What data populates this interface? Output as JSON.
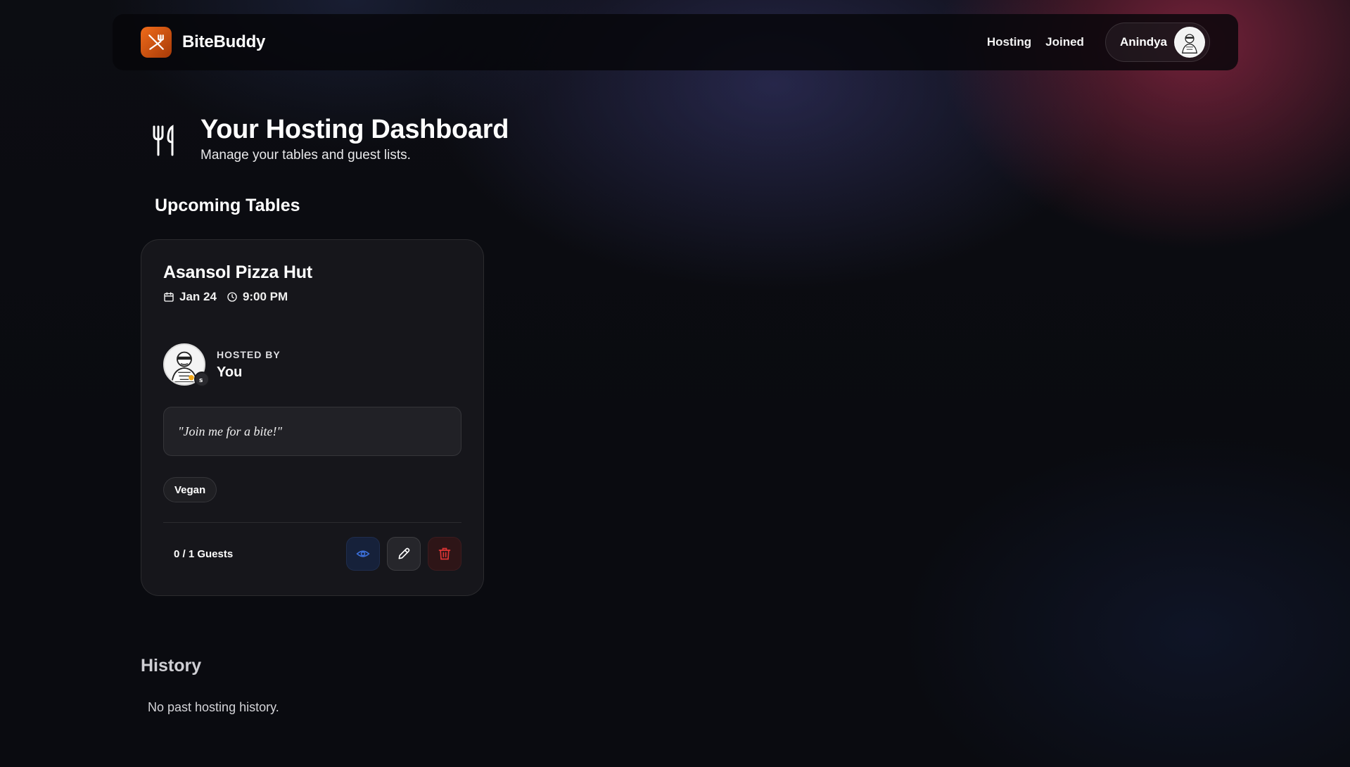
{
  "app": {
    "brand_name": "BiteBuddy",
    "brand_color": "#e8601a"
  },
  "nav": {
    "links": [
      {
        "label": "Hosting"
      },
      {
        "label": "Joined"
      }
    ],
    "user": {
      "name": "Anindya"
    }
  },
  "header": {
    "title": "Your Hosting Dashboard",
    "subtitle": "Manage your tables and guest lists."
  },
  "upcoming": {
    "section_title": "Upcoming Tables",
    "tables": [
      {
        "restaurant": "Asansol Pizza Hut",
        "date": "Jan 24",
        "time": "9:00 PM",
        "hosted_by_label": "HOSTED BY",
        "host_name": "You",
        "message": "\"Join me for a bite!\"",
        "tags": [
          "Vegan"
        ],
        "guests": "0 / 1 Guests",
        "actions": {
          "view_icon": "eye-icon",
          "edit_icon": "pencil-icon",
          "delete_icon": "trash-icon",
          "view_color": "#3b6fd8",
          "delete_color": "#e03535"
        }
      }
    ]
  },
  "history": {
    "section_title": "History",
    "empty_text": "No past hosting history."
  }
}
